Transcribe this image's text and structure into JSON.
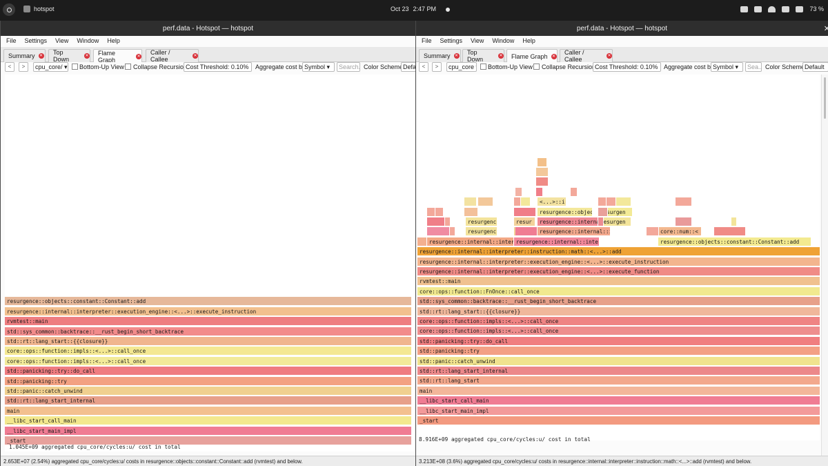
{
  "topbar": {
    "app_title": "hotspot",
    "date": "Oct 23",
    "time": "2:47 PM",
    "battery": "73 %"
  },
  "windows": [
    {
      "title": "perf.data - Hotspot — hotspot",
      "menu": [
        "File",
        "Settings",
        "View",
        "Window",
        "Help"
      ],
      "tabs": [
        "Summary",
        "Top Down",
        "Flame Graph",
        "Caller / Callee"
      ],
      "active_tab": "Flame Graph",
      "toolbar": {
        "event": "cpu_core/",
        "bottom_up": "Bottom-Up View",
        "collapse": "Collapse Recursion",
        "threshold": "Cost Threshold: 0.10%",
        "aggregate_label": "Aggregate cost by:",
        "aggregate_value": "Symbol",
        "search_placeholder": "Search...",
        "color_label": "Color Scheme:",
        "color_value": "Defau"
      },
      "frames": [
        {
          "label": "resurgence::objects::constant::Constant::add",
          "color": "#e6b89a"
        },
        {
          "label": "resurgence::internal::interpreter::execution_engine::<...>::execute_instruction",
          "color": "#f2c08e"
        },
        {
          "label": "rvmtest::main",
          "color": "#ee7d80"
        },
        {
          "label": "std::sys_common::backtrace::__rust_begin_short_backtrace",
          "color": "#f28b8b"
        },
        {
          "label": "std::rt::lang_start::{{closure}}",
          "color": "#f0b58e"
        },
        {
          "label": "core::ops::function::impls::<...>::call_once",
          "color": "#f4e892"
        },
        {
          "label": "core::ops::function::impls::<...>::call_once",
          "color": "#f2ea99"
        },
        {
          "label": "std::panicking::try::do_call",
          "color": "#ef7c80"
        },
        {
          "label": "std::panicking::try",
          "color": "#f3a182"
        },
        {
          "label": "std::panic::catch_unwind",
          "color": "#f0d08f"
        },
        {
          "label": "std::rt::lang_start_internal",
          "color": "#e7a08a"
        },
        {
          "label": "main",
          "color": "#f3c08f"
        },
        {
          "label": "__libc_start_call_main",
          "color": "#f3e88e"
        },
        {
          "label": "__libc_start_main_impl",
          "color": "#f07c93"
        },
        {
          "label": "_start",
          "color": "#e7a19c"
        }
      ],
      "total": "1.045E+09 aggregated cpu_core/cycles:u/ cost in total",
      "status": "2.653E+07 (2.54%) aggregated cpu_core/cycles:u/ costs in resurgence::objects::constant::Constant::add (rvmtest) and below."
    },
    {
      "title": "perf.data - Hotspot — hotspot",
      "menu": [
        "File",
        "Settings",
        "View",
        "Window",
        "Help"
      ],
      "tabs": [
        "Summary",
        "Top Down",
        "Flame Graph",
        "Caller / Callee"
      ],
      "active_tab": "Flame Graph",
      "toolbar": {
        "event": "cpu_core",
        "bottom_up": "Bottom-Up View",
        "collapse": "Collapse Recursion",
        "threshold": "Cost Threshold: 0.10%",
        "aggregate_label": "Aggregate cost by:",
        "aggregate_value": "Symbol",
        "search_placeholder": "Sea...",
        "color_label": "Color Scheme:",
        "color_value": "Default"
      },
      "frames": [
        {
          "label": "resurgence::internal::interpreter::instruction::math::<...>::add",
          "color": "#efa235"
        },
        {
          "label": "resurgence::internal::interpreter::execution_engine::<...>::execute_instruction",
          "color": "#f3b58e"
        },
        {
          "label": "resurgence::internal::interpreter::execution_engine::<...>::execute_function",
          "color": "#f08b86"
        },
        {
          "label": "rvmtest::main",
          "color": "#f0c18f"
        },
        {
          "label": "core::ops::function::FnOnce::call_once",
          "color": "#f1e98f"
        },
        {
          "label": "std::sys_common::backtrace::__rust_begin_short_backtrace",
          "color": "#e7a08a"
        },
        {
          "label": "std::rt::lang_start::{{closure}}",
          "color": "#f0b79b"
        },
        {
          "label": "core::ops::function::impls::<...>::call_once",
          "color": "#ef8484"
        },
        {
          "label": "core::ops::function::impls::<...>::call_once",
          "color": "#ee8e8e"
        },
        {
          "label": "std::panicking::try::do_call",
          "color": "#f07e80"
        },
        {
          "label": "std::panicking::try",
          "color": "#f3a085"
        },
        {
          "label": "std::panic::catch_unwind",
          "color": "#f0e38e"
        },
        {
          "label": "std::rt::lang_start_internal",
          "color": "#ec888a"
        },
        {
          "label": "std::rt::lang_start",
          "color": "#f3a88d"
        },
        {
          "label": "main",
          "color": "#f3b69a"
        },
        {
          "label": "__libc_start_call_main",
          "color": "#f07c93"
        },
        {
          "label": "__libc_start_main_impl",
          "color": "#f39a9a"
        },
        {
          "label": "_start",
          "color": "#f39a80"
        }
      ],
      "upper": [
        {
          "row": 0,
          "label": "resurgence::internal::inter",
          "color": "#f3a885"
        },
        {
          "row": 0,
          "label": "resurgence::internal::interpreter::utils::<...",
          "color": "#f2879a"
        },
        {
          "row": 0,
          "label": "resurgence::objects::constant::Constant::add",
          "color": "#f3ea90"
        },
        {
          "row": 1,
          "label": "<...>::i",
          "color": "#f3e892"
        },
        {
          "row": 1,
          "label": "resurgenc",
          "color": "#f3e39b"
        },
        {
          "row": 1,
          "label": "resur",
          "color": "#f3d29a"
        },
        {
          "row": 1,
          "label": "resurgence::internal::interpr",
          "color": "#f3a88d"
        },
        {
          "row": 1,
          "label": "core::num::<",
          "color": "#f3b88f"
        },
        {
          "row": 2,
          "label": "resurgenc",
          "color": "#f3e39b"
        },
        {
          "row": 2,
          "label": "resur",
          "color": "#f3d29a"
        },
        {
          "row": 2,
          "label": "resurgence::interna",
          "color": "#f08a93"
        },
        {
          "row": 2,
          "label": "resurgen",
          "color": "#f3e49a"
        },
        {
          "row": 3,
          "label": "resurgence::objects",
          "color": "#f3e89b"
        },
        {
          "row": 3,
          "label": "resurgen",
          "color": "#f3ea96"
        },
        {
          "row": 4,
          "label": "<...>::ir",
          "color": "#f3e2a1"
        },
        {
          "row": 0,
          "label": "",
          "color": "#f3b08f"
        },
        {
          "row": 1,
          "label": "",
          "color": "#f08ba2"
        },
        {
          "row": 1,
          "label": "",
          "color": "#f3a89a"
        },
        {
          "row": 1,
          "label": "",
          "color": "#f07c93"
        },
        {
          "row": 1,
          "label": "",
          "color": "#f3a89a"
        },
        {
          "row": 1,
          "label": "",
          "color": "#f08b86"
        },
        {
          "row": 2,
          "label": "",
          "color": "#f07e88"
        },
        {
          "row": 2,
          "label": "",
          "color": "#f3a89a"
        },
        {
          "row": 2,
          "label": "",
          "color": "#ec8c92"
        },
        {
          "row": 2,
          "label": "",
          "color": "#e99a9a"
        },
        {
          "row": 2,
          "label": "",
          "color": "#f3e49a"
        },
        {
          "row": 3,
          "label": "",
          "color": "#f3a89a"
        },
        {
          "row": 3,
          "label": "",
          "color": "#f3a89a"
        },
        {
          "row": 3,
          "label": "",
          "color": "#f3c09a"
        },
        {
          "row": 3,
          "label": "",
          "color": "#f07e88"
        },
        {
          "row": 3,
          "label": "",
          "color": "#e9a09a"
        },
        {
          "row": 4,
          "label": "",
          "color": "#f3e2a1"
        },
        {
          "row": 4,
          "label": "",
          "color": "#f3c89a"
        },
        {
          "row": 4,
          "label": "",
          "color": "#f3a89a"
        },
        {
          "row": 4,
          "label": "",
          "color": "#f3e89b"
        },
        {
          "row": 4,
          "label": "",
          "color": "#f3a89a"
        },
        {
          "row": 4,
          "label": "",
          "color": "#f3a89a"
        },
        {
          "row": 4,
          "label": "",
          "color": "#f3e89b"
        },
        {
          "row": 4,
          "label": "",
          "color": "#f3a89a"
        },
        {
          "row": 5,
          "label": "",
          "color": "#f3b2a4"
        },
        {
          "row": 5,
          "label": "",
          "color": "#f07e88"
        },
        {
          "row": 5,
          "label": "",
          "color": "#f3a89a"
        },
        {
          "row": 6,
          "label": "",
          "color": "#f08b86"
        },
        {
          "row": 7,
          "label": "",
          "color": "#f3c89a"
        },
        {
          "row": 8,
          "label": "",
          "color": "#f3c089"
        }
      ],
      "total": "8.916E+09 aggregated cpu_core/cycles:u/ cost in total",
      "status": "3.213E+08 (3.6%) aggregated cpu_core/cycles:u/ costs in resurgence::internal::interpreter::instruction::math::<...>::add (rvmtest) and below."
    }
  ]
}
